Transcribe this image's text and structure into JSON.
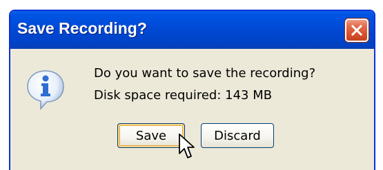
{
  "dialog": {
    "title": "Save Recording?",
    "message_line1": "Do you want to save the recording?",
    "message_line2": "Disk space required: 143 MB",
    "icon": "info-icon",
    "buttons": {
      "save_label": "Save",
      "discard_label": "Discard"
    },
    "default_button": "Save"
  },
  "colors": {
    "titlebar": "#0054e3",
    "dialog_bg": "#ece9d8",
    "close_button": "#d7502b",
    "info_icon": "#2f6fd0"
  }
}
